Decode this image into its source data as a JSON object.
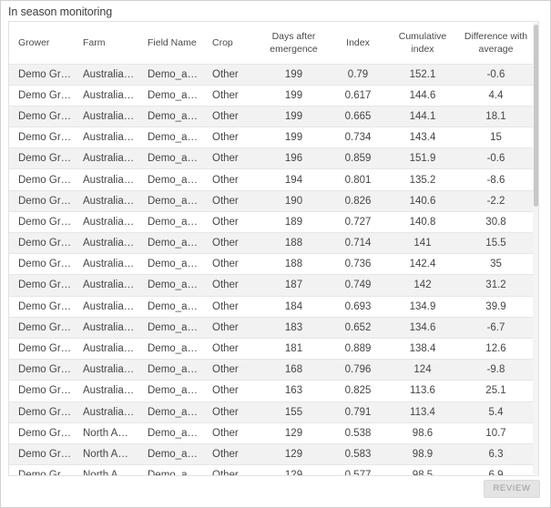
{
  "panel": {
    "title": "In season monitoring",
    "review_label": "REVIEW"
  },
  "table": {
    "columns": [
      {
        "label": "Grower"
      },
      {
        "label": "Farm"
      },
      {
        "label": "Field Name"
      },
      {
        "label": "Crop"
      },
      {
        "label": "Days after emergence"
      },
      {
        "label": "Index"
      },
      {
        "label": "Cumulative index"
      },
      {
        "label": "Difference with average"
      }
    ],
    "rows": [
      [
        "Demo Gro...",
        "Australia D...",
        "Demo_acc...",
        "Other",
        "199",
        "0.79",
        "152.1",
        "-0.6"
      ],
      [
        "Demo Gro...",
        "Australia D...",
        "Demo_acc...",
        "Other",
        "199",
        "0.617",
        "144.6",
        "4.4"
      ],
      [
        "Demo Gro...",
        "Australia D...",
        "Demo_acc...",
        "Other",
        "199",
        "0.665",
        "144.1",
        "18.1"
      ],
      [
        "Demo Gro...",
        "Australia D...",
        "Demo_acc...",
        "Other",
        "199",
        "0.734",
        "143.4",
        "15"
      ],
      [
        "Demo Gro...",
        "Australia D...",
        "Demo_acc...",
        "Other",
        "196",
        "0.859",
        "151.9",
        "-0.6"
      ],
      [
        "Demo Gro...",
        "Australia D...",
        "Demo_acc...",
        "Other",
        "194",
        "0.801",
        "135.2",
        "-8.6"
      ],
      [
        "Demo Gro...",
        "Australia D...",
        "Demo_acc...",
        "Other",
        "190",
        "0.826",
        "140.6",
        "-2.2"
      ],
      [
        "Demo Gro...",
        "Australia D...",
        "Demo_acc...",
        "Other",
        "189",
        "0.727",
        "140.8",
        "30.8"
      ],
      [
        "Demo Gro...",
        "Australia D...",
        "Demo_acc...",
        "Other",
        "188",
        "0.714",
        "141",
        "15.5"
      ],
      [
        "Demo Gro...",
        "Australia D...",
        "Demo_acc...",
        "Other",
        "188",
        "0.736",
        "142.4",
        "35"
      ],
      [
        "Demo Gro...",
        "Australia D...",
        "Demo_acc...",
        "Other",
        "187",
        "0.749",
        "142",
        "31.2"
      ],
      [
        "Demo Gro...",
        "Australia D...",
        "Demo_acc...",
        "Other",
        "184",
        "0.693",
        "134.9",
        "39.9"
      ],
      [
        "Demo Gro...",
        "Australia D...",
        "Demo_acc...",
        "Other",
        "183",
        "0.652",
        "134.6",
        "-6.7"
      ],
      [
        "Demo Gro...",
        "Australia D...",
        "Demo_acc...",
        "Other",
        "181",
        "0.889",
        "138.4",
        "12.6"
      ],
      [
        "Demo Gro...",
        "Australia D...",
        "Demo_acc...",
        "Other",
        "168",
        "0.796",
        "124",
        "-9.8"
      ],
      [
        "Demo Gro...",
        "Australia D...",
        "Demo_acc...",
        "Other",
        "163",
        "0.825",
        "113.6",
        "25.1"
      ],
      [
        "Demo Gro...",
        "Australia D...",
        "Demo_acc...",
        "Other",
        "155",
        "0.791",
        "113.4",
        "5.4"
      ],
      [
        "Demo Gro...",
        "North Amer...",
        "Demo_acc...",
        "Other",
        "129",
        "0.538",
        "98.6",
        "10.7"
      ],
      [
        "Demo Gro...",
        "North Amer...",
        "Demo_acc...",
        "Other",
        "129",
        "0.583",
        "98.9",
        "6.3"
      ],
      [
        "Demo Gro...",
        "North Amer...",
        "Demo_acc...",
        "Other",
        "129",
        "0.577",
        "98.5",
        "6.9"
      ]
    ]
  }
}
